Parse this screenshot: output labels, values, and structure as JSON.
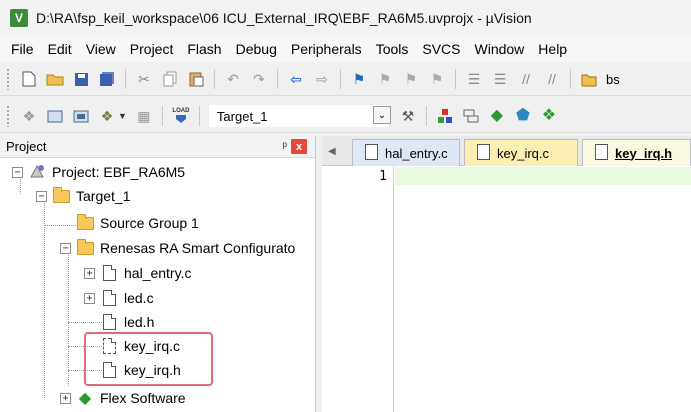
{
  "window": {
    "title": "D:\\RA\\fsp_keil_workspace\\06 ICU_External_IRQ\\EBF_RA6M5.uvprojx - µVision",
    "app_icon_letter": "V"
  },
  "menu": [
    "File",
    "Edit",
    "View",
    "Project",
    "Flash",
    "Debug",
    "Peripherals",
    "Tools",
    "SVCS",
    "Window",
    "Help"
  ],
  "toolbar": {
    "target_value": "Target_1",
    "truncated_text": "bs",
    "load_label": "LOAD"
  },
  "project_panel": {
    "title": "Project",
    "pin_glyph": "ᵖ",
    "close_glyph": "x",
    "tree": {
      "root": "Project: EBF_RA6M5",
      "target": "Target_1",
      "source_group": "Source Group 1",
      "renesas_group": "Renesas RA Smart Configurato",
      "files": [
        "hal_entry.c",
        "led.c",
        "led.h",
        "key_irq.c",
        "key_irq.h"
      ],
      "flex": "Flex Software"
    }
  },
  "editor": {
    "tabs": [
      "hal_entry.c",
      "key_irq.c",
      "key_irq.h"
    ],
    "active_tab": "key_irq.h",
    "line_numbers": [
      "1"
    ]
  },
  "colors": {
    "highlight_border": "#e36a7a",
    "current_line": "#e8fbe0",
    "tab_keyc": "#fbefb3",
    "close_red": "#e24b3b"
  }
}
